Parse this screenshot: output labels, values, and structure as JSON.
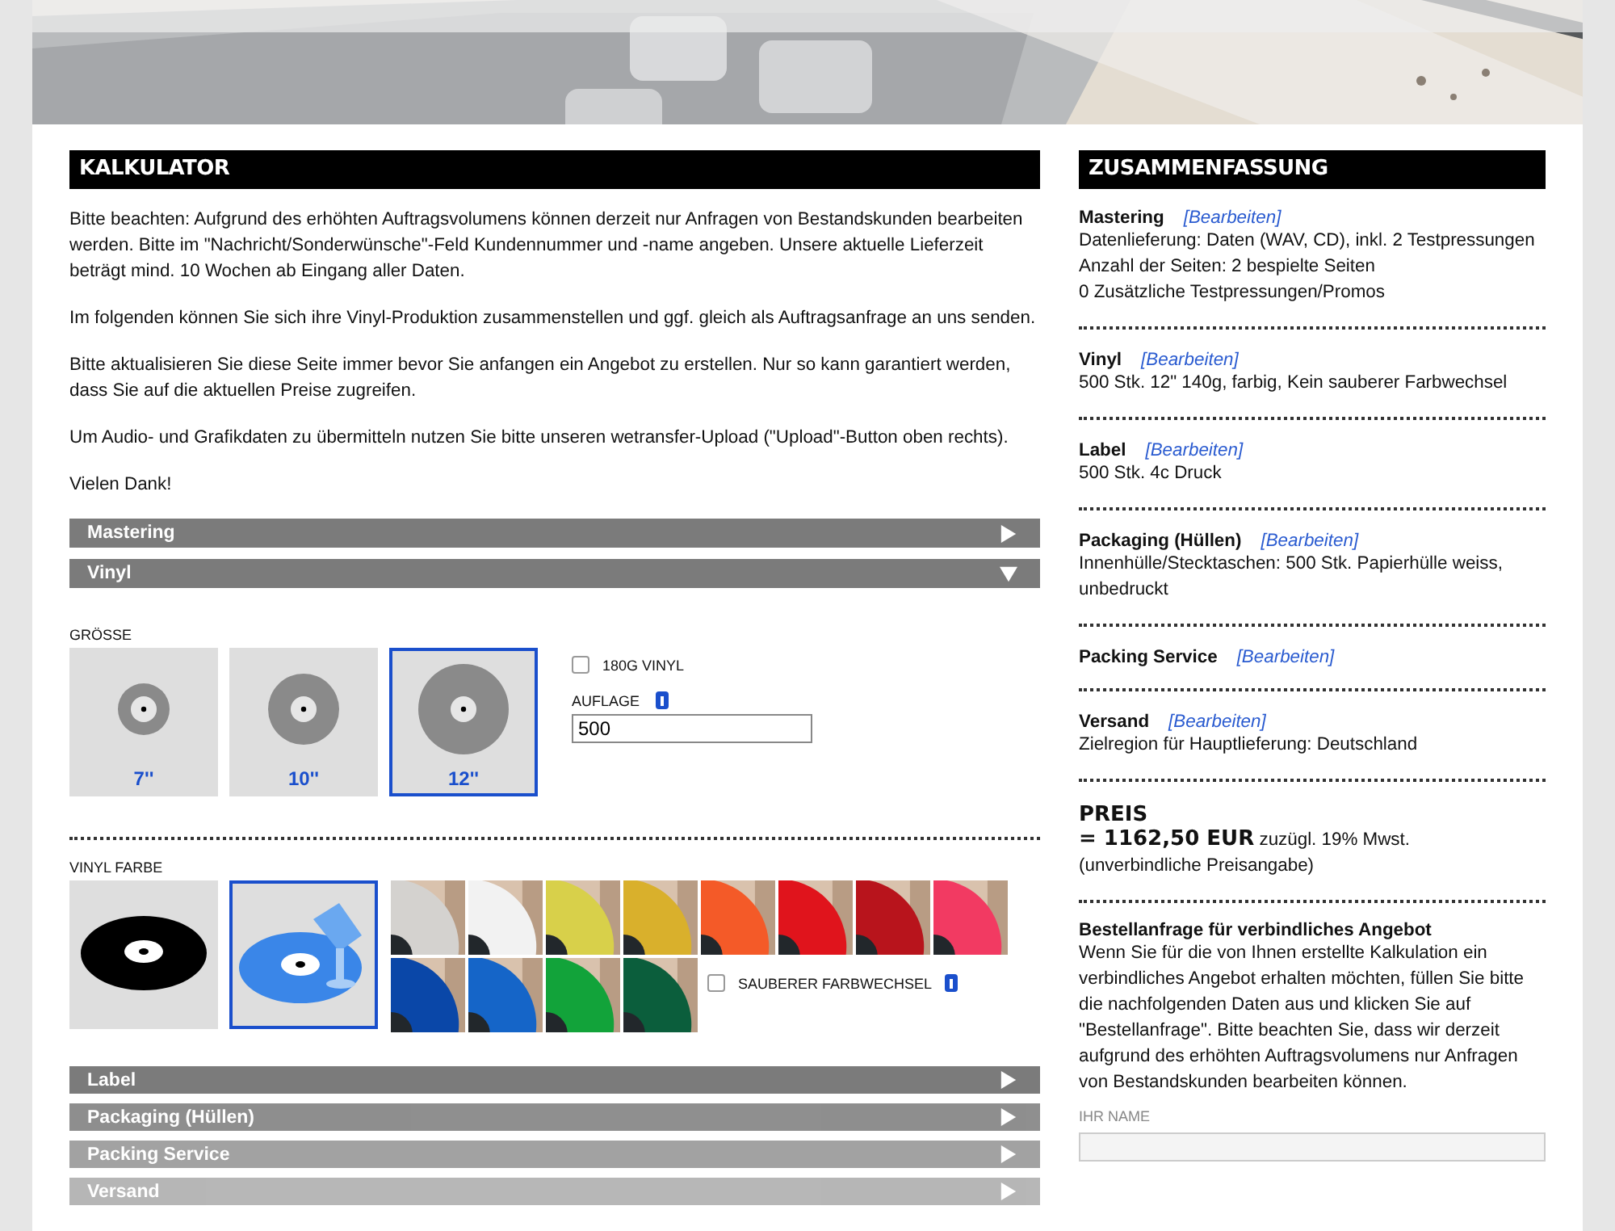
{
  "calculator": {
    "title": "KALKULATOR",
    "paragraphs": [
      "Bitte beachten: Aufgrund des erhöhten Auftragsvolumens können derzeit nur Anfragen von Bestandskunden bearbeiten werden. Bitte im \"Nachricht/Sonderwünsche\"-Feld Kundennummer und -name angeben. Unsere aktuelle Lieferzeit beträgt mind. 10 Wochen ab Eingang aller Daten.",
      "Im folgenden können Sie sich ihre Vinyl-Produktion zusammenstellen und ggf. gleich als Auftragsanfrage an uns senden.",
      "Bitte aktualisieren Sie diese Seite immer bevor Sie anfangen ein Angebot zu erstellen. Nur so kann garantiert werden, dass Sie auf die aktuellen Preise zugreifen.",
      "Um Audio- und Grafikdaten zu übermitteln nutzen Sie bitte unseren wetransfer-Upload (\"Upload\"-Button oben rechts).",
      "Vielen Dank!"
    ],
    "sections_top": [
      {
        "label": "Mastering",
        "expanded": false
      },
      {
        "label": "Vinyl",
        "expanded": true
      }
    ],
    "size": {
      "label": "GRÖSSE",
      "options": [
        {
          "label": "7''",
          "selected": false
        },
        {
          "label": "10''",
          "selected": false
        },
        {
          "label": "12''",
          "selected": true
        }
      ]
    },
    "heavy_vinyl": {
      "label": "180G VINYL",
      "checked": false
    },
    "quantity": {
      "label": "AUFLAGE",
      "value": "500"
    },
    "color": {
      "label": "VINYL FARBE",
      "types": [
        {
          "kind": "black",
          "selected": false
        },
        {
          "kind": "colored",
          "selected": true
        }
      ],
      "swatches": [
        {
          "color": "#d4d2cf"
        },
        {
          "color": "#f2f2f2"
        },
        {
          "color": "#d8d04a"
        },
        {
          "color": "#d9b02c"
        },
        {
          "color": "#f45a28"
        },
        {
          "color": "#e0141c"
        },
        {
          "color": "#b8141c"
        },
        {
          "color": "#f23a62"
        },
        {
          "color": "#0a47a8"
        },
        {
          "color": "#1565c8"
        },
        {
          "color": "#12a33a"
        },
        {
          "color": "#0b5e3c"
        }
      ],
      "clean_change": {
        "label": "SAUBERER FARBWECHSEL",
        "checked": false
      }
    },
    "sections_bottom": [
      {
        "label": "Label",
        "expanded": false
      },
      {
        "label": "Packaging (Hüllen)",
        "expanded": false
      },
      {
        "label": "Packing Service",
        "expanded": false
      },
      {
        "label": "Versand",
        "expanded": false
      }
    ]
  },
  "summary": {
    "title": "ZUSAMMENFASSUNG",
    "sections": [
      {
        "title": "Mastering",
        "edit": "[Bearbeiten]",
        "lines": [
          "Datenlieferung: Daten (WAV, CD), inkl. 2 Testpressungen",
          "Anzahl der Seiten: 2 bespielte Seiten",
          "0 Zusätzliche Testpressungen/Promos"
        ]
      },
      {
        "title": "Vinyl",
        "edit": "[Bearbeiten]",
        "lines": [
          "500 Stk. 12\" 140g, farbig, Kein sauberer Farbwechsel"
        ]
      },
      {
        "title": "Label",
        "edit": "[Bearbeiten]",
        "lines": [
          "500 Stk. 4c Druck"
        ]
      },
      {
        "title": "Packaging (Hüllen)",
        "edit": "[Bearbeiten]",
        "lines": [
          "Innenhülle/Stecktaschen: 500 Stk. Papierhülle weiss, unbedruckt"
        ]
      },
      {
        "title": "Packing Service",
        "edit": "[Bearbeiten]"
      },
      {
        "title": "Versand",
        "edit": "[Bearbeiten]",
        "lines": [
          "Zielregion für Hauptlieferung: Deutschland"
        ]
      }
    ],
    "price": {
      "title": "PREIS",
      "amount": "= 1162,50 EUR",
      "tax": "zuzügl. 19% Mwst.",
      "note": "(unverbindliche Preisangabe)"
    },
    "request": {
      "title": "Bestellanfrage für verbindliches Angebot",
      "text": "Wenn Sie für die von Ihnen erstellte Kalkulation ein verbindliches Angebot erhalten möchten, füllen Sie bitte die nachfolgenden Daten aus und klicken Sie auf \"Bestellanfrage\". Bitte beachten Sie, dass wir derzeit aufgrund des erhöhten Auftragsvolumens nur Anfragen von Bestandskunden bearbeiten können.",
      "name_label": "IHR NAME"
    }
  }
}
